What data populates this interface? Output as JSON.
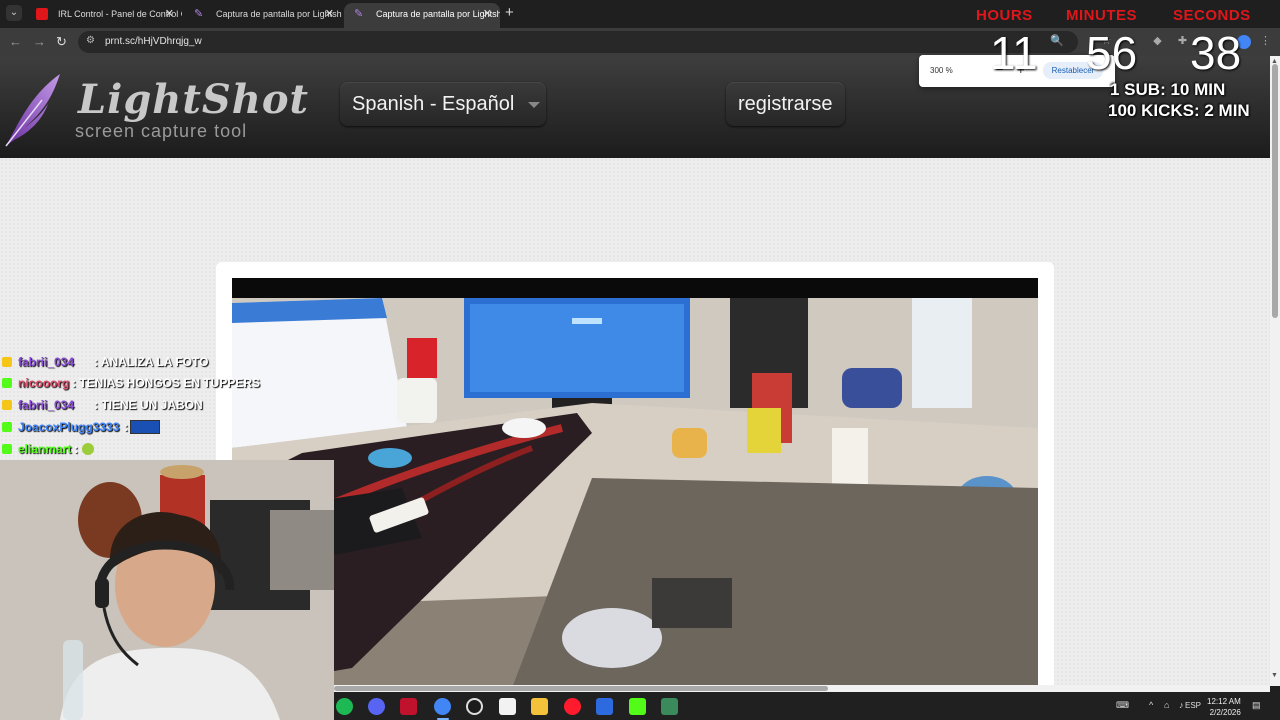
{
  "browser": {
    "tabs": [
      {
        "label": "IRL Control - Panel de Control C",
        "active": false,
        "favicon_color": "#e0161b"
      },
      {
        "label": "Captura de pantalla por Lightsh",
        "active": false,
        "favicon_color": "#9b59b6"
      },
      {
        "label": "Captura de pantalla por Lightsh",
        "active": true,
        "favicon_color": "#9b59b6"
      }
    ],
    "new_tab_label": "+",
    "url": "prnt.sc/hHjVDhrqjg_w",
    "zoom_popup": {
      "value": "300 %",
      "minus": "−",
      "plus": "+",
      "reset": "Restablecer"
    }
  },
  "lightshot": {
    "logo_title": "LightShot",
    "logo_subtitle": "screen capture tool",
    "language_button": "Spanish - Español",
    "register_button": "registrarse"
  },
  "overlay": {
    "timer_labels": [
      "HOURS",
      "MINUTES",
      "SECONDS"
    ],
    "timer_values": [
      "11",
      "56",
      "38"
    ],
    "goals": [
      "1 SUB: 10 MIN",
      "100 KICKS: 2 MIN"
    ],
    "chat": [
      {
        "user": "fabrii_034",
        "message": ": ANALIZA LA FOTO",
        "badge_color": "#f5c518"
      },
      {
        "user": "nicooorg",
        "message": ": TENIAS HONGOS EN TUPPERS",
        "badge_color": "#53fc18"
      },
      {
        "user": "fabrii_034",
        "message": ": TIENE UN JABON",
        "badge_color": "#f5c518"
      },
      {
        "user": "JoacoxPlugg3333",
        "message": ":",
        "badge_color": "#53fc18"
      },
      {
        "user": "elianmart",
        "message": ":",
        "badge_color": "#53fc18"
      }
    ]
  },
  "taskbar": {
    "icons": [
      "spotify-icon",
      "discord-icon",
      "voicemod-icon",
      "chrome-icon",
      "obs-icon",
      "app-icon",
      "file-explorer-icon",
      "opera-icon",
      "vpn-icon",
      "kick-icon",
      "stacks-icon"
    ],
    "tray_language": "ESP",
    "time": "12:12 AM",
    "date": "2/2/2026"
  },
  "colors": {
    "accent_red": "#e0161b",
    "chrome_bg": "#1f1f1f",
    "chrome_toolbar": "#3c3c3c",
    "lightshot_bg": "#ededed"
  }
}
